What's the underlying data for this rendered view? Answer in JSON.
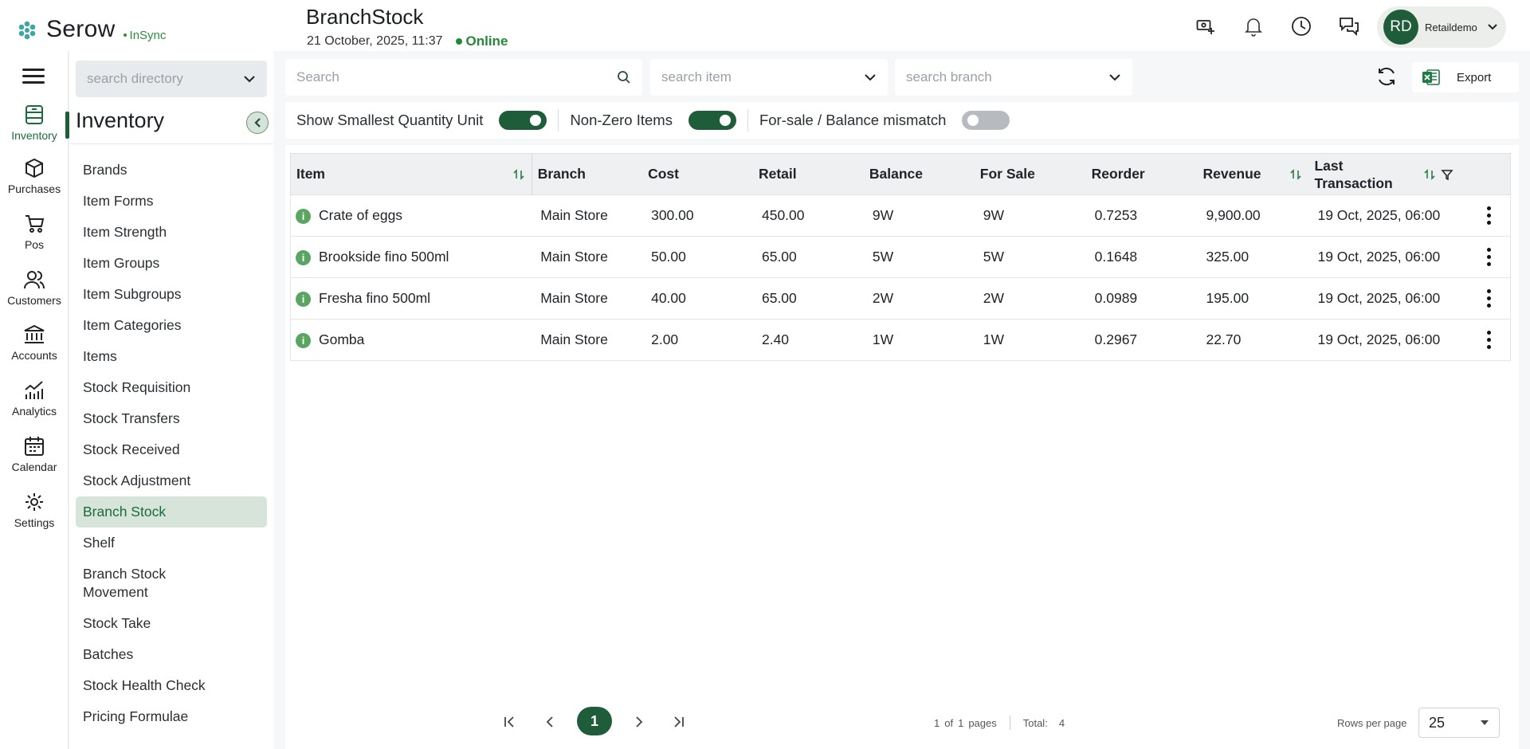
{
  "app": {
    "name": "Serow",
    "sync_status": "InSync"
  },
  "header": {
    "title": "BranchStock",
    "datetime": "21 October, 2025, 11:37",
    "connection": "Online",
    "user_initials": "RD",
    "user_name": "Retaildemo"
  },
  "rail": {
    "items": [
      {
        "label": "Inventory",
        "icon": "inventory-icon"
      },
      {
        "label": "Purchases",
        "icon": "box-icon"
      },
      {
        "label": "Pos",
        "icon": "cart-icon"
      },
      {
        "label": "Customers",
        "icon": "users-icon"
      },
      {
        "label": "Accounts",
        "icon": "bank-icon"
      },
      {
        "label": "Analytics",
        "icon": "analytics-icon"
      },
      {
        "label": "Calendar",
        "icon": "calendar-icon"
      },
      {
        "label": "Settings",
        "icon": "gear-icon"
      }
    ]
  },
  "sidebar": {
    "search_placeholder": "search directory",
    "section_title": "Inventory",
    "items": [
      {
        "label": "Brands"
      },
      {
        "label": "Item Forms"
      },
      {
        "label": "Item Strength"
      },
      {
        "label": "Item Groups"
      },
      {
        "label": "Item Subgroups"
      },
      {
        "label": "Item Categories"
      },
      {
        "label": "Items"
      },
      {
        "label": "Stock Requisition"
      },
      {
        "label": "Stock Transfers"
      },
      {
        "label": "Stock Received"
      },
      {
        "label": "Stock Adjustment"
      },
      {
        "label": "Branch Stock"
      },
      {
        "label": "Shelf"
      },
      {
        "label": "Branch Stock Movement"
      },
      {
        "label": "Stock Take"
      },
      {
        "label": "Batches"
      },
      {
        "label": "Stock Health Check"
      },
      {
        "label": "Pricing Formulae"
      }
    ]
  },
  "toolbar": {
    "search_placeholder": "Search",
    "item_placeholder": "search item",
    "branch_placeholder": "search branch",
    "export_label": "Export"
  },
  "filters": {
    "smallest_unit_label": "Show Smallest Quantity Unit",
    "smallest_unit_on": true,
    "non_zero_label": "Non-Zero Items",
    "non_zero_on": true,
    "mismatch_label": "For-sale / Balance mismatch",
    "mismatch_on": false
  },
  "table": {
    "headers": {
      "item": "Item",
      "branch": "Branch",
      "cost": "Cost",
      "retail": "Retail",
      "balance": "Balance",
      "for_sale": "For Sale",
      "reorder": "Reorder",
      "revenue": "Revenue",
      "last_transaction": "Last Transaction"
    },
    "rows": [
      {
        "item": "Crate of eggs",
        "branch": "Main Store",
        "cost": "300.00",
        "retail": "450.00",
        "balance": "9W",
        "for_sale": "9W",
        "reorder": "0.7253",
        "revenue": "9,900.00",
        "last_transaction": "19 Oct, 2025, 06:00"
      },
      {
        "item": "Brookside fino 500ml",
        "branch": "Main Store",
        "cost": "50.00",
        "retail": "65.00",
        "balance": "5W",
        "for_sale": "5W",
        "reorder": "0.1648",
        "revenue": "325.00",
        "last_transaction": "19 Oct, 2025, 06:00"
      },
      {
        "item": "Fresha fino 500ml",
        "branch": "Main Store",
        "cost": "40.00",
        "retail": "65.00",
        "balance": "2W",
        "for_sale": "2W",
        "reorder": "0.0989",
        "revenue": "195.00",
        "last_transaction": "19 Oct, 2025, 06:00"
      },
      {
        "item": "Gomba",
        "branch": "Main Store",
        "cost": "2.00",
        "retail": "2.40",
        "balance": "1W",
        "for_sale": "1W",
        "reorder": "0.2967",
        "revenue": "22.70",
        "last_transaction": "19 Oct, 2025, 06:00"
      }
    ]
  },
  "pagination": {
    "current_page": "1",
    "page_of_label": "of",
    "pages_label": "pages",
    "current": "1",
    "total_pages": "1",
    "total_label": "Total:",
    "total": "4",
    "rows_per_page_label": "Rows per page",
    "rows_per_page": "25"
  },
  "colors": {
    "brand": "#1f5d3a",
    "online": "#23883a",
    "active_bg": "#d6e4da"
  }
}
